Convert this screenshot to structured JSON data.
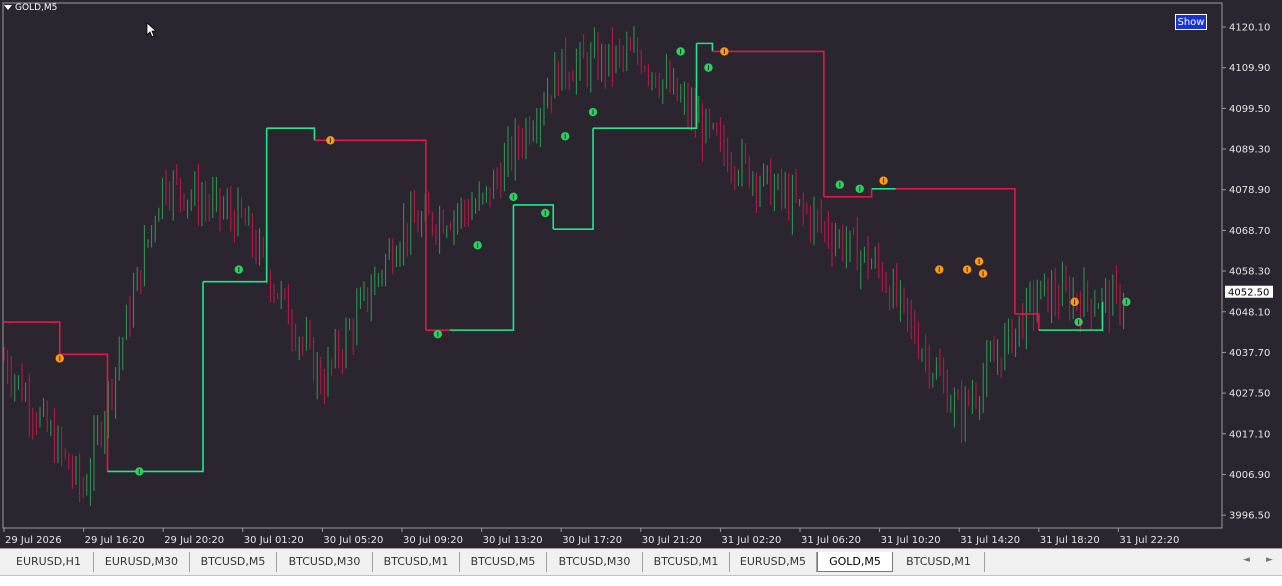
{
  "window": {
    "title": "GOLD,M5",
    "show_button": "Show"
  },
  "colors": {
    "background": "#2b2530",
    "bull": "#2e9a55",
    "bear": "#c2174a",
    "line_up": "#1de88b",
    "line_down": "#e0184a",
    "marker_up": "#2fd05f",
    "marker_down": "#ff9a12",
    "current_price_bg": "#ffffff"
  },
  "price_axis": {
    "labels": [
      "4120.10",
      "4109.90",
      "4099.50",
      "4089.30",
      "4078.90",
      "4068.70",
      "4058.30",
      "4048.10",
      "4037.70",
      "4027.50",
      "4017.10",
      "4006.90",
      "3996.50"
    ],
    "current": "4052.50"
  },
  "time_axis": {
    "labels": [
      "29 Jul 2026",
      "29 Jul 16:20",
      "29 Jul 20:20",
      "30 Jul 01:20",
      "30 Jul 05:20",
      "30 Jul 09:20",
      "30 Jul 13:20",
      "30 Jul 17:20",
      "30 Jul 21:20",
      "31 Jul 02:20",
      "31 Jul 06:20",
      "31 Jul 10:20",
      "31 Jul 14:20",
      "31 Jul 18:20",
      "31 Jul 22:20"
    ]
  },
  "tabs": [
    "EURUSD,H1",
    "EURUSD,M30",
    "BTCUSD,M5",
    "BTCUSD,M30",
    "BTCUSD,M1",
    "BTCUSD,M5",
    "BTCUSD,M30",
    "BTCUSD,M1",
    "EURUSD,M5",
    "GOLD,M5",
    "BTCUSD,M1"
  ],
  "active_tab": 9,
  "chart_data": {
    "type": "candlestick",
    "symbol": "GOLD,M5",
    "ylim": [
      3994.0,
      4124.0
    ],
    "x": [
      "29 Jul 2026",
      "29 Jul 16:20",
      "29 Jul 20:20",
      "30 Jul 01:20",
      "30 Jul 05:20",
      "30 Jul 09:20",
      "30 Jul 13:20",
      "30 Jul 17:20",
      "30 Jul 21:20",
      "31 Jul 02:20",
      "31 Jul 06:20",
      "31 Jul 10:20",
      "31 Jul 14:20",
      "31 Jul 18:20",
      "31 Jul 22:20"
    ],
    "close_path": [
      [
        "29 Jul 2026",
        4036
      ],
      [
        "29 Jul 16:20",
        4003
      ],
      [
        "29 Jul 20:20",
        4080
      ],
      [
        "30 Jul 01:20",
        4070
      ],
      [
        "30 Jul 05:20",
        4030
      ],
      [
        "30 Jul 09:20",
        4068
      ],
      [
        "30 Jul 13:20",
        4074
      ],
      [
        "30 Jul 17:20",
        4108
      ],
      [
        "30 Jul 21:20",
        4111
      ],
      [
        "31 Jul 02:20",
        4088
      ],
      [
        "31 Jul 06:20",
        4073
      ],
      [
        "31 Jul 10:20",
        4058
      ],
      [
        "31 Jul 14:20",
        4022
      ],
      [
        "31 Jul 18:20",
        4052
      ],
      [
        "31 Jul 22:20",
        4050
      ]
    ],
    "trailing_stop": [
      [
        0,
        4045,
        "down"
      ],
      [
        0.7,
        4037,
        "down"
      ],
      [
        1.3,
        4008,
        "up"
      ],
      [
        2.5,
        4055,
        "up"
      ],
      [
        3.3,
        4093,
        "up"
      ],
      [
        3.9,
        4090,
        "down"
      ],
      [
        5.3,
        4043,
        "down"
      ],
      [
        5.6,
        4043,
        "up"
      ],
      [
        6.4,
        4074,
        "up"
      ],
      [
        6.9,
        4068,
        "up"
      ],
      [
        7.4,
        4093,
        "up"
      ],
      [
        8.7,
        4114,
        "up"
      ],
      [
        8.9,
        4112,
        "down"
      ],
      [
        10.3,
        4076,
        "down"
      ],
      [
        10.9,
        4078,
        "up"
      ],
      [
        11.2,
        4078,
        "down"
      ],
      [
        12.7,
        4047,
        "down"
      ],
      [
        13.0,
        4043,
        "up"
      ],
      [
        13.8,
        4050,
        "up"
      ]
    ],
    "markers": [
      {
        "at": 0.7,
        "price": 4036,
        "type": "sell"
      },
      {
        "at": 1.7,
        "price": 4008,
        "type": "buy"
      },
      {
        "at": 2.95,
        "price": 4058,
        "type": "buy"
      },
      {
        "at": 4.1,
        "price": 4090,
        "type": "sell"
      },
      {
        "at": 5.45,
        "price": 4042,
        "type": "buy"
      },
      {
        "at": 5.95,
        "price": 4064,
        "type": "buy"
      },
      {
        "at": 6.4,
        "price": 4076,
        "type": "buy"
      },
      {
        "at": 6.8,
        "price": 4072,
        "type": "buy"
      },
      {
        "at": 7.05,
        "price": 4091,
        "type": "buy"
      },
      {
        "at": 7.4,
        "price": 4097,
        "type": "buy"
      },
      {
        "at": 8.5,
        "price": 4112,
        "type": "buy"
      },
      {
        "at": 8.85,
        "price": 4108,
        "type": "buy"
      },
      {
        "at": 9.05,
        "price": 4112,
        "type": "sell"
      },
      {
        "at": 10.5,
        "price": 4079,
        "type": "buy"
      },
      {
        "at": 10.75,
        "price": 4078,
        "type": "buy"
      },
      {
        "at": 11.05,
        "price": 4080,
        "type": "sell"
      },
      {
        "at": 11.75,
        "price": 4058,
        "type": "sell"
      },
      {
        "at": 12.1,
        "price": 4058,
        "type": "sell"
      },
      {
        "at": 12.25,
        "price": 4060,
        "type": "sell"
      },
      {
        "at": 12.3,
        "price": 4057,
        "type": "sell"
      },
      {
        "at": 13.45,
        "price": 4050,
        "type": "sell"
      },
      {
        "at": 13.5,
        "price": 4045,
        "type": "buy"
      },
      {
        "at": 14.1,
        "price": 4050,
        "type": "buy"
      }
    ]
  }
}
